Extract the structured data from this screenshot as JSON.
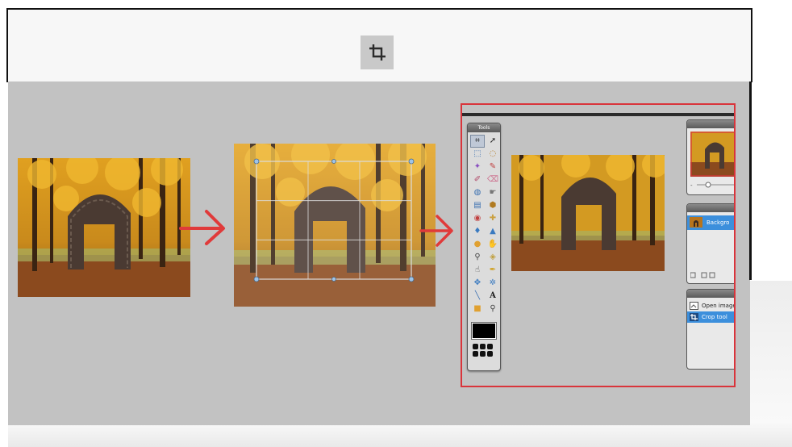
{
  "header": {
    "icon": "crop-icon",
    "icon_tile_color": "#c9c9c9"
  },
  "steps": [
    {
      "name": "original-photo"
    },
    {
      "name": "crop-grid-photo"
    },
    {
      "name": "cropped-result"
    }
  ],
  "editor": {
    "highlight_color": "#d9343b",
    "toolbox": {
      "title": "Tools",
      "tools": [
        "crop-icon",
        "move-icon",
        "marquee-icon",
        "lasso-icon",
        "wand-icon",
        "pencil-icon",
        "brush-icon",
        "eraser-icon",
        "bucket-icon",
        "smudge-icon",
        "gradient-icon",
        "stamp-icon",
        "redeye-icon",
        "spotheal-icon",
        "blur-icon",
        "sharpen-icon",
        "dodge-icon",
        "burn-icon",
        "zoom-wand-icon",
        "sponge-icon",
        "hand-icon",
        "colorpicker-icon",
        "pan-icon",
        "settings-icon",
        "line-icon",
        "text-icon",
        "shape-icon",
        "zoom-icon"
      ],
      "foreground_color": "#000000"
    },
    "layers_panel": {
      "layer_name": "Backgro"
    },
    "history_panel": {
      "items": [
        {
          "label": "Open image"
        },
        {
          "label": "Crop tool",
          "selected": true
        }
      ]
    }
  }
}
